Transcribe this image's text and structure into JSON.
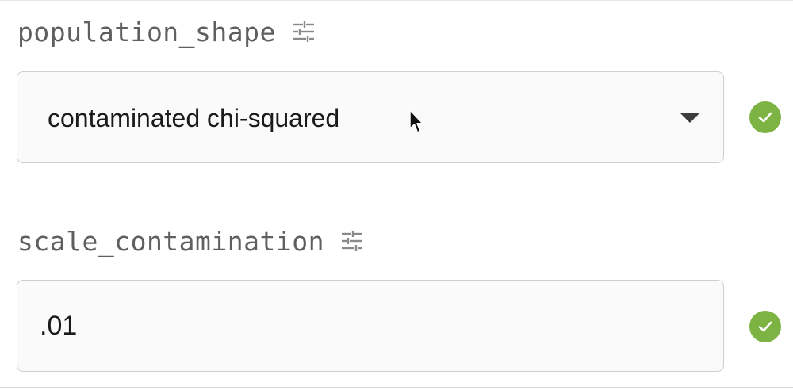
{
  "fields": [
    {
      "name": "population_shape",
      "settings_icon": "tune-sliders-icon",
      "control_type": "select",
      "selected_value": "contaminated chi-squared",
      "dropdown_icon": "caret-down-icon",
      "status_icon": "check-circle-icon",
      "status_color": "#7cb342"
    },
    {
      "name": "scale_contamination",
      "settings_icon": "tune-sliders-icon",
      "control_type": "text",
      "value": ".01",
      "status_icon": "check-circle-icon",
      "status_color": "#7cb342"
    }
  ],
  "colors": {
    "label_text": "#5f5f5f",
    "control_border": "#cfcfcf",
    "control_background": "#fafafa",
    "success": "#7cb342"
  }
}
